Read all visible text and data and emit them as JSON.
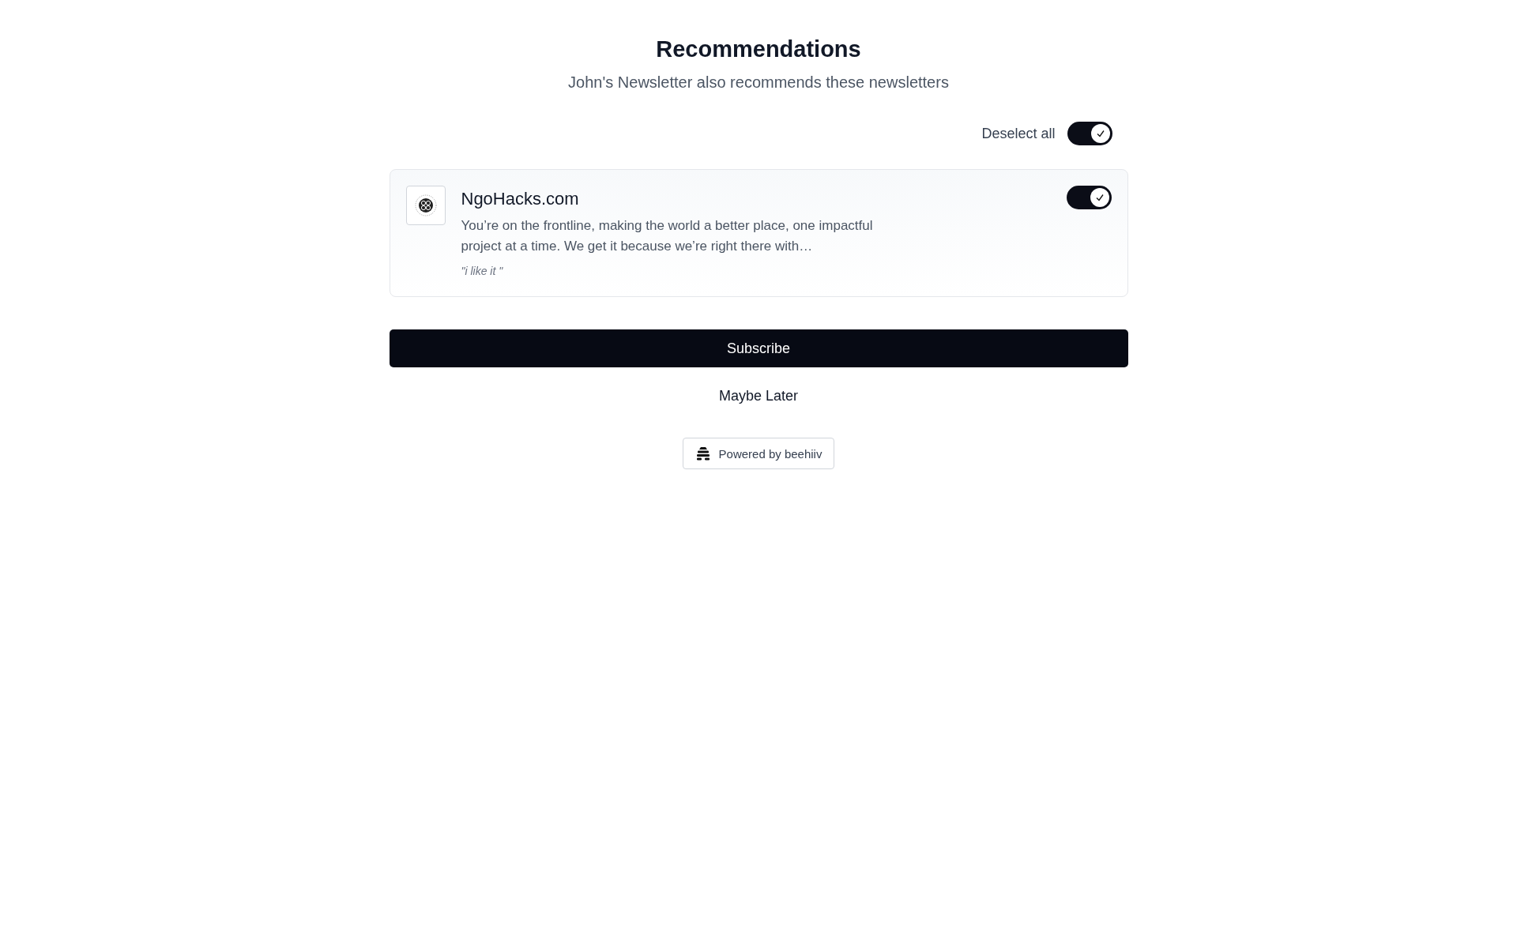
{
  "title": "Recommendations",
  "subtitle": "John's Newsletter also recommends these newsletters",
  "deselect_all": {
    "label": "Deselect all",
    "on": true
  },
  "newsletters": [
    {
      "name": "NgoHacks.com",
      "description": "You’re on the frontline, making the world a better place, one impactful project at a time. We get it because we’re right there with…",
      "quote": "\"i like it \"",
      "selected": true
    }
  ],
  "subscribe_button": "Subscribe",
  "maybe_later": "Maybe Later",
  "powered_by": "Powered by beehiiv"
}
